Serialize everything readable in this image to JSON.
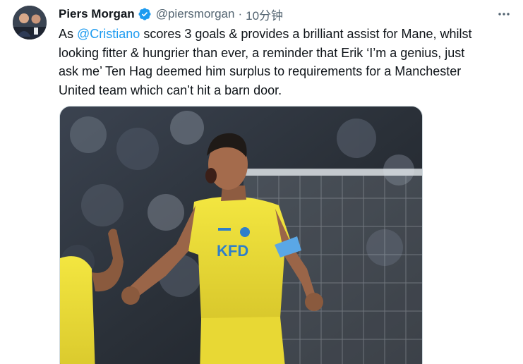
{
  "tweet": {
    "author": {
      "display_name": "Piers Morgan",
      "handle": "@piersmorgan",
      "verified": true,
      "avatar_icon": "avatar-photo"
    },
    "separator": "·",
    "timestamp": "10分钟",
    "text": {
      "line1_prefix": "As ",
      "mention": "@Cristiano",
      "line1_suffix": " scores 3 goals & provides a brilliant assist for Mane, whilst",
      "line2": "looking fitter & hungrier than ever, a reminder that Erik ‘I’m a genius, just",
      "line3": "ask me’ Ten Hag deemed him surplus to requirements for a Manchester",
      "line4": "United team which can’t hit a barn door."
    },
    "media": {
      "kind": "photo",
      "jersey_text": "KFD",
      "colors": {
        "kit_yellow": "#efe03a",
        "armband_blue": "#5aa7e6",
        "background_dark": "#2a3038"
      }
    },
    "colors": {
      "accent": "#1d9bf0",
      "text_primary": "#0f1419",
      "text_secondary": "#536471"
    }
  }
}
